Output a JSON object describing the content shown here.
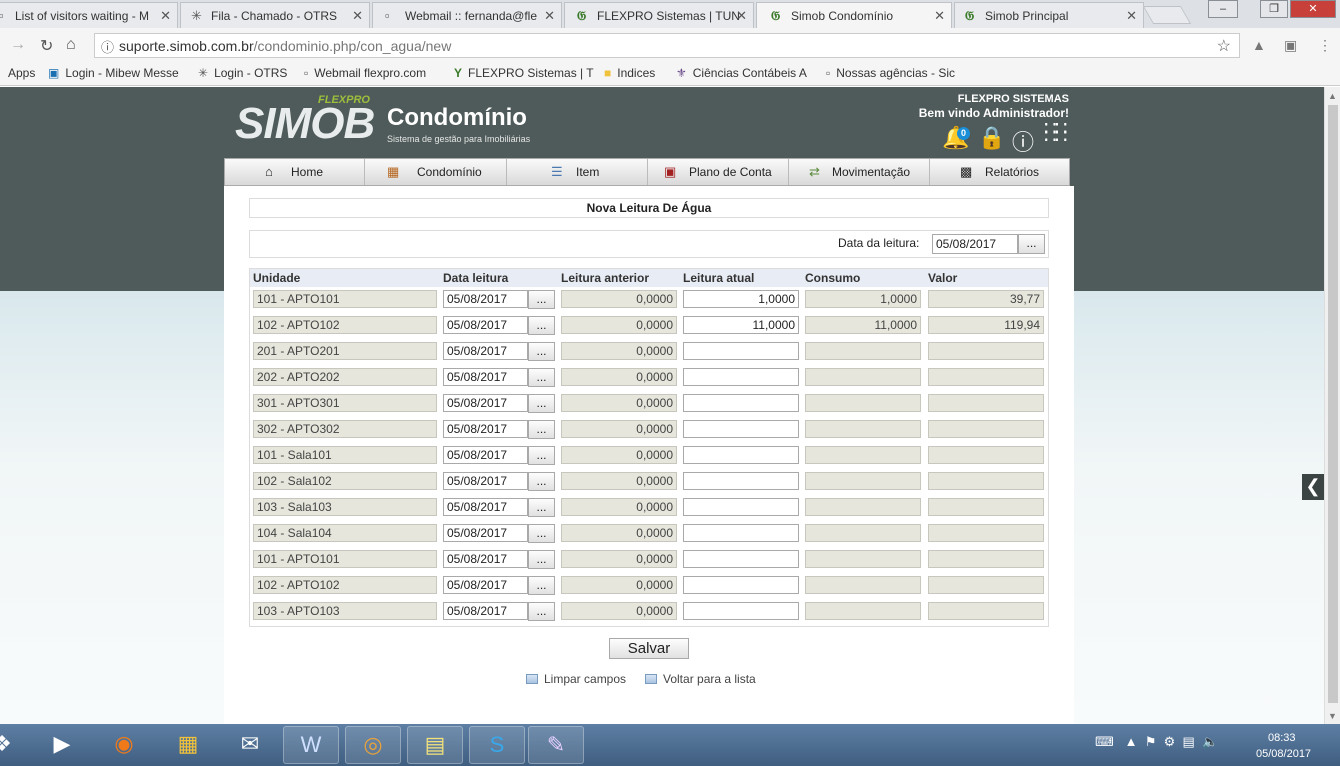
{
  "browser": {
    "tabs": [
      {
        "title": "List of visitors waiting - M",
        "icon": "document-icon"
      },
      {
        "title": "Fila - Chamado - OTRS",
        "icon": "otrs-icon"
      },
      {
        "title": "Webmail :: fernanda@fle",
        "icon": "document-icon"
      },
      {
        "title": "FLEXPRO Sistemas | TUN",
        "icon": "flexpro-icon"
      },
      {
        "title": "Simob Condomínio",
        "icon": "flexpro-icon"
      },
      {
        "title": "Simob Principal",
        "icon": "flexpro-icon"
      }
    ],
    "url_host": "suporte.simob.com.br",
    "url_path": "/condominio.php/con_agua/new",
    "bookmarks": [
      "Apps",
      "Login - Mibew Messe",
      "Login - OTRS",
      "Webmail flexpro.com",
      "FLEXPRO Sistemas | T",
      "Indices",
      "Ciências Contábeis A",
      "Nossas agências - Sic"
    ]
  },
  "header": {
    "logo_simob": "SIMOB",
    "logo_flex": "FLEXPRO",
    "logo_title": "Condomínio",
    "logo_subtitle": "Sistema de gestão para Imobiliárias",
    "company": "FLEXPRO SISTEMAS",
    "welcome": "Bem vindo Administrador!",
    "notifications": "0"
  },
  "menu": [
    "Home",
    "Condomínio",
    "Item",
    "Plano de Conta",
    "Movimentação",
    "Relatórios"
  ],
  "form": {
    "title": "Nova Leitura De Água",
    "date_label": "Data da leitura:",
    "date_value": "05/08/2017",
    "dots": "...",
    "columns": [
      "Unidade",
      "Data leitura",
      "Leitura anterior",
      "Leitura atual",
      "Consumo",
      "Valor"
    ],
    "rows": [
      {
        "unidade": "101 - APTO101",
        "data": "05/08/2017",
        "anterior": "0,0000",
        "atual": "1,0000",
        "consumo": "1,0000",
        "valor": "39,77"
      },
      {
        "unidade": "102 - APTO102",
        "data": "05/08/2017",
        "anterior": "0,0000",
        "atual": "11,0000",
        "consumo": "11,0000",
        "valor": "119,94"
      },
      {
        "unidade": "201 - APTO201",
        "data": "05/08/2017",
        "anterior": "0,0000",
        "atual": "",
        "consumo": "",
        "valor": ""
      },
      {
        "unidade": "202 - APTO202",
        "data": "05/08/2017",
        "anterior": "0,0000",
        "atual": "",
        "consumo": "",
        "valor": ""
      },
      {
        "unidade": "301 - APTO301",
        "data": "05/08/2017",
        "anterior": "0,0000",
        "atual": "",
        "consumo": "",
        "valor": ""
      },
      {
        "unidade": "302 - APTO302",
        "data": "05/08/2017",
        "anterior": "0,0000",
        "atual": "",
        "consumo": "",
        "valor": ""
      },
      {
        "unidade": "101 - Sala101",
        "data": "05/08/2017",
        "anterior": "0,0000",
        "atual": "",
        "consumo": "",
        "valor": ""
      },
      {
        "unidade": "102 - Sala102",
        "data": "05/08/2017",
        "anterior": "0,0000",
        "atual": "",
        "consumo": "",
        "valor": ""
      },
      {
        "unidade": "103 - Sala103",
        "data": "05/08/2017",
        "anterior": "0,0000",
        "atual": "",
        "consumo": "",
        "valor": ""
      },
      {
        "unidade": "104 - Sala104",
        "data": "05/08/2017",
        "anterior": "0,0000",
        "atual": "",
        "consumo": "",
        "valor": ""
      },
      {
        "unidade": "101 - APTO101",
        "data": "05/08/2017",
        "anterior": "0,0000",
        "atual": "",
        "consumo": "",
        "valor": ""
      },
      {
        "unidade": "102 - APTO102",
        "data": "05/08/2017",
        "anterior": "0,0000",
        "atual": "",
        "consumo": "",
        "valor": ""
      },
      {
        "unidade": "103 - APTO103",
        "data": "05/08/2017",
        "anterior": "0,0000",
        "atual": "",
        "consumo": "",
        "valor": ""
      }
    ],
    "save_label": "Salvar",
    "clear_label": "Limpar campos",
    "back_label": "Voltar para a lista"
  },
  "taskbar": {
    "time": "08:33",
    "date": "05/08/2017"
  }
}
